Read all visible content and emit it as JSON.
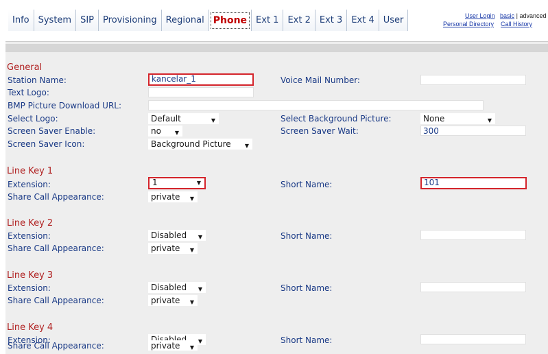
{
  "tabs": [
    {
      "label": "Info"
    },
    {
      "label": "System"
    },
    {
      "label": "SIP"
    },
    {
      "label": "Provisioning"
    },
    {
      "label": "Regional"
    },
    {
      "label": "Phone",
      "active": true
    },
    {
      "label": "Ext 1"
    },
    {
      "label": "Ext 2"
    },
    {
      "label": "Ext 3"
    },
    {
      "label": "Ext 4"
    },
    {
      "label": "User"
    }
  ],
  "toplinks": {
    "user_login": "User Login",
    "basic": "basic",
    "sep": "|",
    "advanced": "advanced",
    "personal_directory": "Personal Directory",
    "call_history": "Call History"
  },
  "general": {
    "title": "General",
    "station_name_label": "Station Name:",
    "station_name_value": "kancelar_1",
    "voice_mail_label": "Voice Mail Number:",
    "voice_mail_value": "",
    "text_logo_label": "Text Logo:",
    "text_logo_value": "",
    "bmp_url_label": "BMP Picture Download URL:",
    "bmp_url_value": "",
    "select_logo_label": "Select Logo:",
    "select_logo_value": "Default",
    "select_bg_label": "Select Background Picture:",
    "select_bg_value": "None",
    "screen_saver_enable_label": "Screen Saver Enable:",
    "screen_saver_enable_value": "no",
    "screen_saver_wait_label": "Screen Saver Wait:",
    "screen_saver_wait_value": "300",
    "screen_saver_icon_label": "Screen Saver Icon:",
    "screen_saver_icon_value": "Background Picture"
  },
  "line_keys": [
    {
      "title": "Line Key 1",
      "extension_label": "Extension:",
      "extension_value": "1",
      "short_name_label": "Short Name:",
      "short_name_value": "101",
      "share_label": "Share Call Appearance:",
      "share_value": "private"
    },
    {
      "title": "Line Key 2",
      "extension_label": "Extension:",
      "extension_value": "Disabled",
      "short_name_label": "Short Name:",
      "short_name_value": "",
      "share_label": "Share Call Appearance:",
      "share_value": "private"
    },
    {
      "title": "Line Key 3",
      "extension_label": "Extension:",
      "extension_value": "Disabled",
      "short_name_label": "Short Name:",
      "short_name_value": "",
      "share_label": "Share Call Appearance:",
      "share_value": "private"
    },
    {
      "title": "Line Key 4",
      "extension_label": "Extension:",
      "extension_value": "Disabled",
      "short_name_label": "Short Name:",
      "short_name_value": "",
      "share_label": "Share Call Appearance:",
      "share_value": "private"
    }
  ],
  "colors": {
    "highlight_border": "#d4242b",
    "section_title": "#b02020",
    "label": "#1a3a86"
  }
}
